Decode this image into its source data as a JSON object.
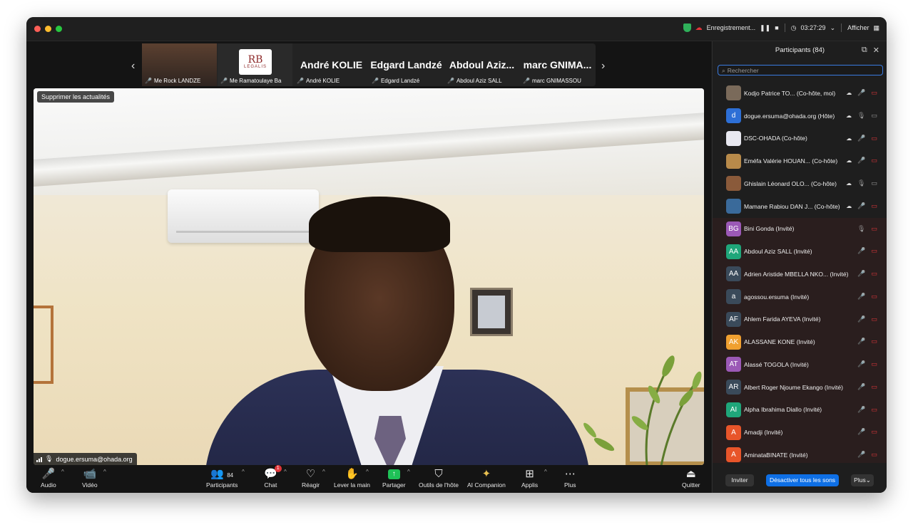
{
  "titlebar": {
    "recording": "Enregistrement...",
    "timer": "03:27:29",
    "view_label": "Afficher"
  },
  "strip": {
    "tiles": [
      {
        "label": "Me Rock LANDZE",
        "big": ""
      },
      {
        "label": "Me Ramatoulaye Ba",
        "big": "",
        "logo_main": "RB",
        "logo_sub": "LEGALIS"
      },
      {
        "label": "André KOLIE",
        "big": "André KOLIE"
      },
      {
        "label": "Edgard Landzé",
        "big": "Edgard Landzé"
      },
      {
        "label": "Abdoul Aziz SALL",
        "big": "Abdoul Aziz..."
      },
      {
        "label": "marc GNIMASSOU",
        "big": "marc GNIMA..."
      }
    ]
  },
  "video": {
    "top_chip": "Supprimer les actualités",
    "speaker": "dogue.ersuma@ohada.org"
  },
  "toolbar": {
    "audio": "Audio",
    "video": "Vidéo",
    "participants": "Participants",
    "participants_count": "84",
    "chat": "Chat",
    "chat_badge": "1",
    "react": "Réagir",
    "raise_hand": "Lever la main",
    "share": "Partager",
    "host_tools": "Outils de l'hôte",
    "ai": "AI Companion",
    "apps": "Applis",
    "more": "Plus",
    "quit": "Quitter"
  },
  "panel": {
    "title": "Participants (84)",
    "search_placeholder": "Rechercher",
    "invite": "Inviter",
    "mute_all": "Désactiver tous les sons",
    "more": "Plus",
    "participants": [
      {
        "initials": "",
        "name": "Kodjo Patrice TO...  (Co-hôte, moi)",
        "color": "#7a6a5a",
        "mic": "off",
        "cam": "off",
        "cloud": true
      },
      {
        "initials": "d",
        "name": "dogue.ersuma@ohada.org (Hôte)",
        "color": "#2d6fd6",
        "mic": "on",
        "cam": "on",
        "cloud": true
      },
      {
        "initials": "",
        "name": "DSC-OHADA (Co-hôte)",
        "color": "#e8e8f0",
        "mic": "off",
        "cam": "off",
        "cloud": true
      },
      {
        "initials": "",
        "name": "Eméfa Valérie HOUAN...  (Co-hôte)",
        "color": "#b88a4a",
        "mic": "off",
        "cam": "off",
        "cloud": true
      },
      {
        "initials": "",
        "name": "Ghislain Léonard OLO...  (Co-hôte)",
        "color": "#8a5a3a",
        "mic": "on",
        "cam": "on",
        "cloud": true
      },
      {
        "initials": "",
        "name": "Mamane Rabiou DAN J...  (Co-hôte)",
        "color": "#3a6a9a",
        "mic": "off",
        "cam": "off",
        "cloud": true
      },
      {
        "initials": "BG",
        "name": "Bini Gonda (Invité)",
        "color": "#9b59b6",
        "mic": "on",
        "cam": "off",
        "cloud": false
      },
      {
        "initials": "AA",
        "name": "Abdoul Aziz SALL (Invité)",
        "color": "#1fa67a",
        "mic": "off",
        "cam": "off",
        "cloud": false
      },
      {
        "initials": "AA",
        "name": "Adrien Aristide MBELLA NKO...  (Invité)",
        "color": "#3a4a5a",
        "mic": "off",
        "cam": "off",
        "cloud": false
      },
      {
        "initials": "a",
        "name": "agossou.ersuma (Invité)",
        "color": "#3a4a5a",
        "mic": "off",
        "cam": "off",
        "cloud": false
      },
      {
        "initials": "AF",
        "name": "Ahlem Farida AYEVA (Invité)",
        "color": "#3a4a5a",
        "mic": "off",
        "cam": "off",
        "cloud": false
      },
      {
        "initials": "AK",
        "name": "ALASSANE KONE (Invité)",
        "color": "#f0a030",
        "mic": "off",
        "cam": "off",
        "cloud": false
      },
      {
        "initials": "AT",
        "name": "Alassé TOGOLA (Invité)",
        "color": "#9b59b6",
        "mic": "off",
        "cam": "off",
        "cloud": false
      },
      {
        "initials": "AR",
        "name": "Albert Roger Njoume Ekango (Invité)",
        "color": "#3a4a5a",
        "mic": "off",
        "cam": "off",
        "cloud": false
      },
      {
        "initials": "AI",
        "name": "Alpha Ibrahima Diallo (Invité)",
        "color": "#1fa67a",
        "mic": "off",
        "cam": "off",
        "cloud": false
      },
      {
        "initials": "A",
        "name": "Amadji (Invité)",
        "color": "#e8552a",
        "mic": "off",
        "cam": "off",
        "cloud": false
      },
      {
        "initials": "A",
        "name": "AminataBINATE (Invité)",
        "color": "#e8552a",
        "mic": "off",
        "cam": "off",
        "cloud": false
      }
    ]
  }
}
